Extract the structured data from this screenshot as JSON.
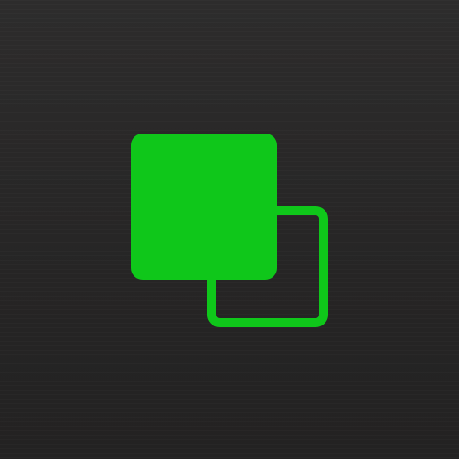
{
  "icon": {
    "name": "layers-copy-icon",
    "background_color": "#262525",
    "accent_color": "#0fc71a"
  }
}
